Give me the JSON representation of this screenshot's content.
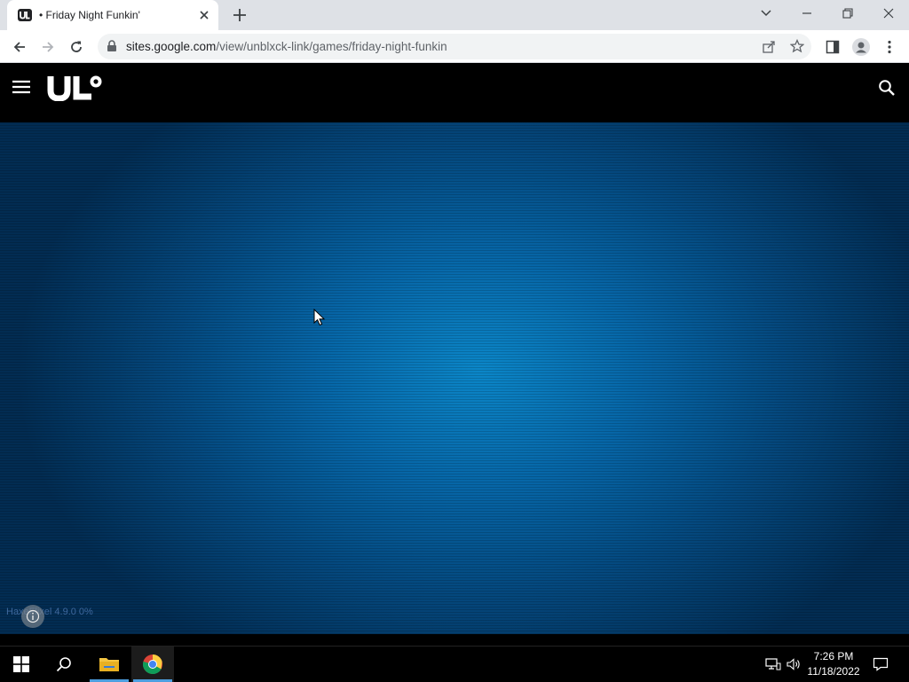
{
  "browser": {
    "tab": {
      "title": "• Friday Night Funkin'"
    },
    "url": {
      "domain": "sites.google.com",
      "path": "/view/unblxck-link/games/friday-night-funkin"
    }
  },
  "site": {
    "logo_text": "UL",
    "icons": {
      "menu": "hamburger-menu-icon",
      "search": "search-icon"
    }
  },
  "game": {
    "status_text": "HaxeFlixel 4.9.0 0%",
    "background_color": "#0665a6",
    "glow_color": "#0b86c8"
  },
  "taskbar": {
    "time": "7:26 PM",
    "date": "11/18/2022",
    "apps": [
      "file-explorer",
      "chrome"
    ],
    "accent": "#4d9fe0"
  }
}
